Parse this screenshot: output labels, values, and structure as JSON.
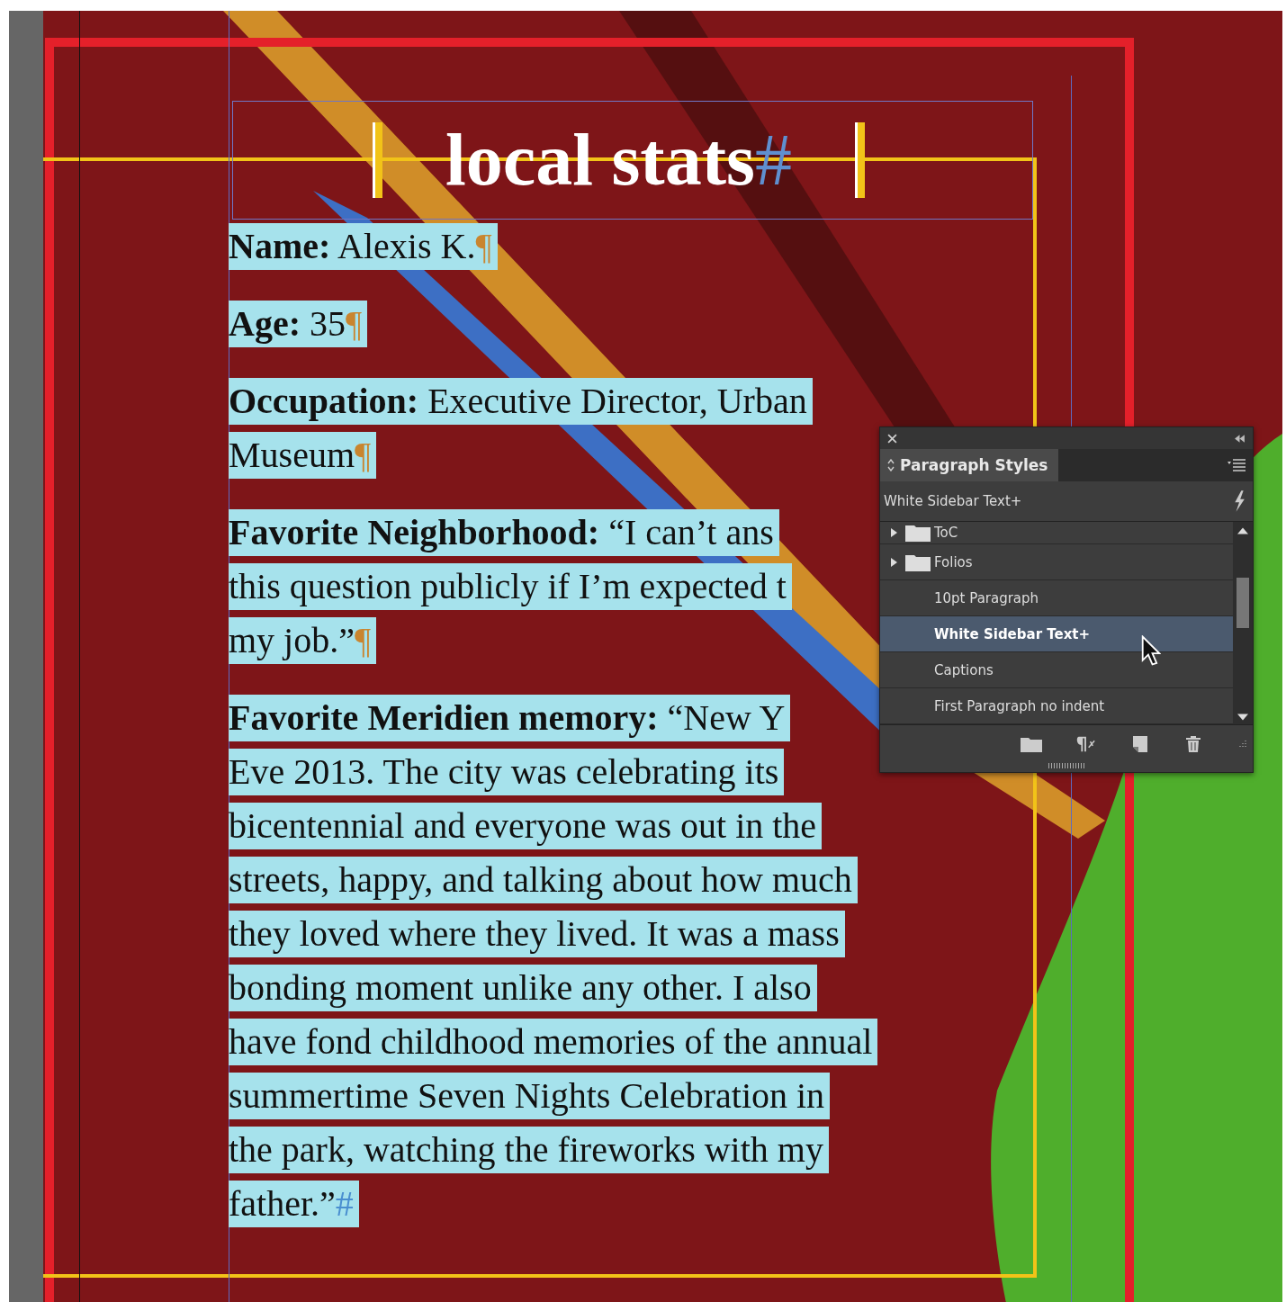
{
  "document": {
    "title": "local stats",
    "title_end_mark": "#",
    "paragraphs": [
      {
        "lines": [
          "**Name:** Alexis K."
        ],
        "end_mark": "¶"
      },
      {
        "lines": [
          "**Age:** 35"
        ],
        "end_mark": "¶"
      },
      {
        "lines": [
          "**Occupation:** Executive Director, Urban",
          "Museum"
        ],
        "end_mark": "¶"
      },
      {
        "lines": [
          "**Favorite Neighborhood:** “I can’t ans",
          "this question publicly if I’m expected t",
          "my job.”"
        ],
        "end_mark": "¶"
      },
      {
        "lines": [
          "**Favorite Meridien memory:** “New Y",
          "Eve 2013. The city was celebrating its",
          "bicentennial and everyone was out in the",
          "streets, happy, and talking about how much",
          "they loved where they lived. It was a mass",
          "bonding moment unlike any other. I also",
          "have fond childhood memories of the annual",
          "summertime Seven Nights Celebration in",
          "the park, watching the fireworks with my",
          "father.”"
        ],
        "end_mark": "#"
      }
    ]
  },
  "panel": {
    "title": "Paragraph Styles",
    "current_style": "White Sidebar Text+",
    "styles": [
      {
        "label": "ToC",
        "kind": "group",
        "expanded": false,
        "selected": false
      },
      {
        "label": "Folios",
        "kind": "group",
        "expanded": false,
        "selected": false
      },
      {
        "label": "10pt Paragraph",
        "kind": "style",
        "selected": false
      },
      {
        "label": "White Sidebar Text+",
        "kind": "style",
        "selected": true
      },
      {
        "label": "Captions",
        "kind": "style",
        "selected": false
      },
      {
        "label": "First Paragraph no indent",
        "kind": "style",
        "selected": false
      }
    ]
  }
}
